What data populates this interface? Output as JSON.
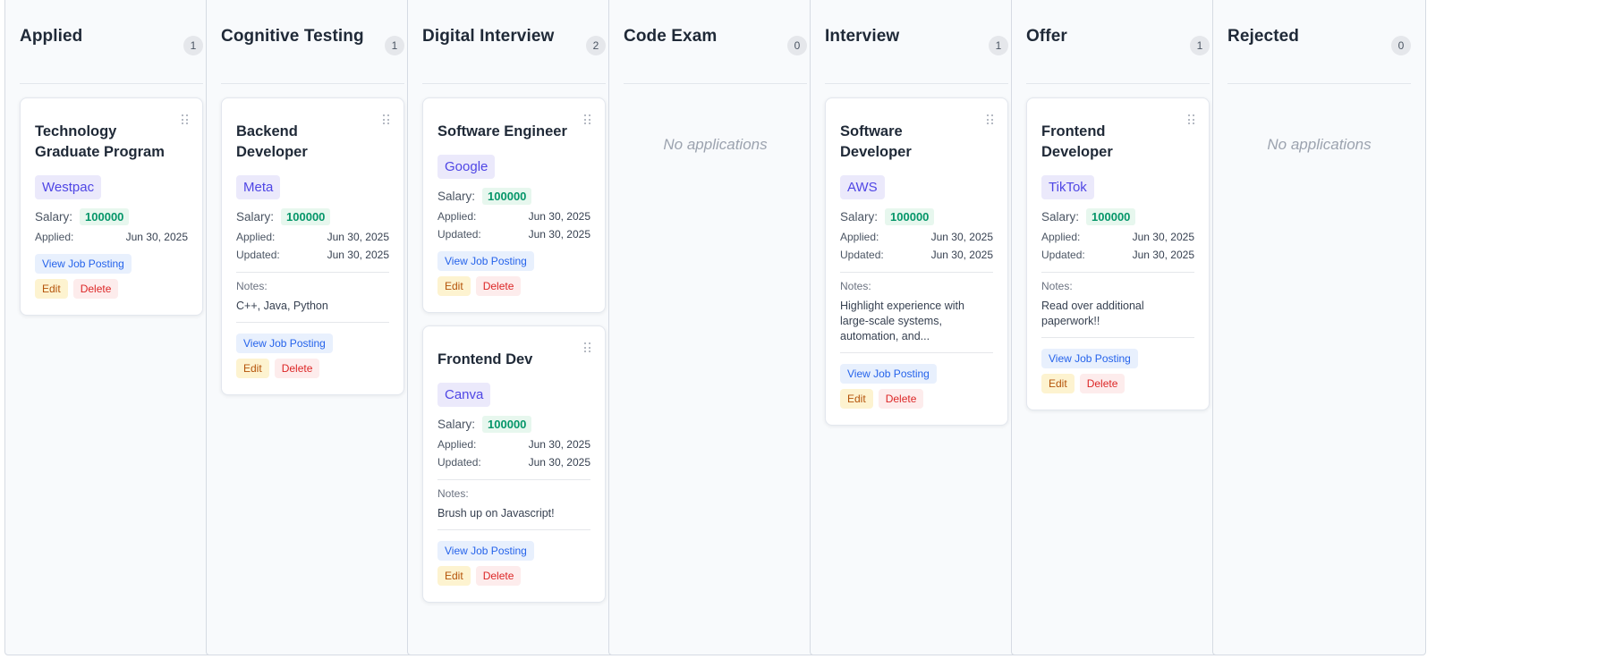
{
  "columns": [
    {
      "title": "Applied",
      "count": "1",
      "empty_text": "",
      "cards": [
        {
          "title": "Technology Graduate Program",
          "company": "Westpac",
          "salary_label": "Salary:",
          "salary": "100000",
          "applied_label": "Applied:",
          "applied": "Jun 30, 2025",
          "updated_label": "",
          "updated": "",
          "notes_label": "",
          "notes": "",
          "view_label": "View Job Posting",
          "edit_label": "Edit",
          "delete_label": "Delete"
        }
      ]
    },
    {
      "title": "Cognitive Testing",
      "count": "1",
      "empty_text": "",
      "cards": [
        {
          "title": "Backend Developer",
          "company": "Meta",
          "salary_label": "Salary:",
          "salary": "100000",
          "applied_label": "Applied:",
          "applied": "Jun 30, 2025",
          "updated_label": "Updated:",
          "updated": "Jun 30, 2025",
          "notes_label": "Notes:",
          "notes": "C++, Java, Python",
          "view_label": "View Job Posting",
          "edit_label": "Edit",
          "delete_label": "Delete"
        }
      ]
    },
    {
      "title": "Digital Interview",
      "count": "2",
      "empty_text": "",
      "cards": [
        {
          "title": "Software Engineer",
          "company": "Google",
          "salary_label": "Salary:",
          "salary": "100000",
          "applied_label": "Applied:",
          "applied": "Jun 30, 2025",
          "updated_label": "Updated:",
          "updated": "Jun 30, 2025",
          "notes_label": "",
          "notes": "",
          "view_label": "View Job Posting",
          "edit_label": "Edit",
          "delete_label": "Delete"
        },
        {
          "title": "Frontend Dev",
          "company": "Canva",
          "salary_label": "Salary:",
          "salary": "100000",
          "applied_label": "Applied:",
          "applied": "Jun 30, 2025",
          "updated_label": "Updated:",
          "updated": "Jun 30, 2025",
          "notes_label": "Notes:",
          "notes": "Brush up on Javascript!",
          "view_label": "View Job Posting",
          "edit_label": "Edit",
          "delete_label": "Delete"
        }
      ]
    },
    {
      "title": "Code Exam",
      "count": "0",
      "empty_text": "No applications",
      "cards": []
    },
    {
      "title": "Interview",
      "count": "1",
      "empty_text": "",
      "cards": [
        {
          "title": "Software Developer",
          "company": "AWS",
          "salary_label": "Salary:",
          "salary": "100000",
          "applied_label": "Applied:",
          "applied": "Jun 30, 2025",
          "updated_label": "Updated:",
          "updated": "Jun 30, 2025",
          "notes_label": "Notes:",
          "notes": "Highlight experience with large-scale systems, automation, and...",
          "view_label": "View Job Posting",
          "edit_label": "Edit",
          "delete_label": "Delete"
        }
      ]
    },
    {
      "title": "Offer",
      "count": "1",
      "empty_text": "",
      "cards": [
        {
          "title": "Frontend Developer",
          "company": "TikTok",
          "salary_label": "Salary:",
          "salary": "100000",
          "applied_label": "Applied:",
          "applied": "Jun 30, 2025",
          "updated_label": "Updated:",
          "updated": "Jun 30, 2025",
          "notes_label": "Notes:",
          "notes": "Read over additional paperwork!!",
          "view_label": "View Job Posting",
          "edit_label": "Edit",
          "delete_label": "Delete"
        }
      ]
    },
    {
      "title": "Rejected",
      "count": "0",
      "empty_text": "No applications",
      "cards": []
    }
  ],
  "icons": {
    "drag_handle": "drag-handle-icon"
  },
  "colors": {
    "company_bg": "#ebe9fb",
    "company_text": "#4f46e5",
    "salary_bg": "#e7f7ee",
    "salary_text": "#059669",
    "view_bg": "#e8f0fd",
    "view_text": "#2563eb",
    "edit_bg": "#fdf3d0",
    "edit_text": "#b45309",
    "delete_bg": "#fdecec",
    "delete_text": "#dc2626"
  }
}
